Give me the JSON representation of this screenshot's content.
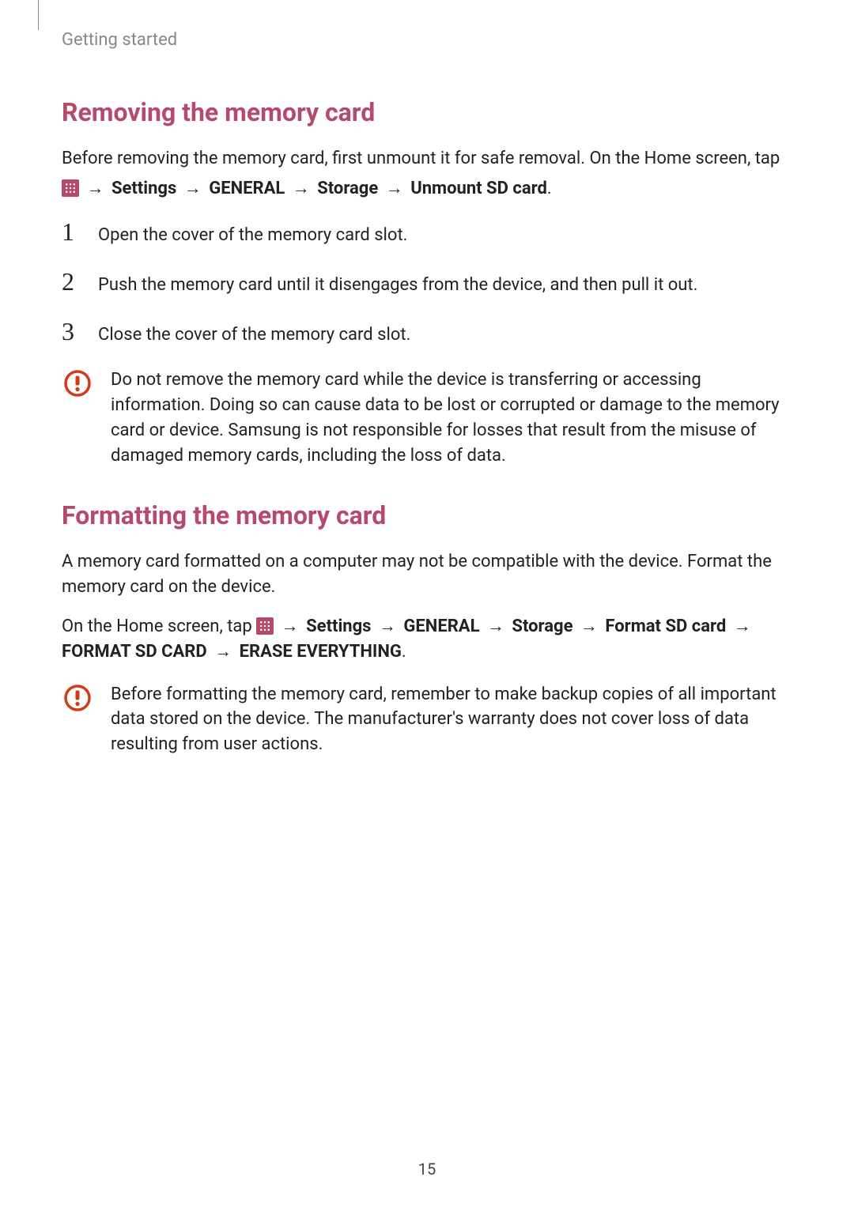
{
  "header": {
    "section_label": "Getting started"
  },
  "section1": {
    "title": "Removing the memory card",
    "intro": "Before removing the memory card, first unmount it for safe removal. On the Home screen, tap ",
    "nav": {
      "settings": "Settings",
      "general": "GENERAL",
      "storage": "Storage",
      "unmount": "Unmount SD card"
    },
    "steps": [
      "Open the cover of the memory card slot.",
      "Push the memory card until it disengages from the device, and then pull it out.",
      "Close the cover of the memory card slot."
    ],
    "caution": "Do not remove the memory card while the device is transferring or accessing information. Doing so can cause data to be lost or corrupted or damage to the memory card or device. Samsung is not responsible for losses that result from the misuse of damaged memory cards, including the loss of data."
  },
  "section2": {
    "title": "Formatting the memory card",
    "intro": "A memory card formatted on a computer may not be compatible with the device. Format the memory card on the device.",
    "nav_lead": "On the Home screen, tap ",
    "nav": {
      "settings": "Settings",
      "general": "GENERAL",
      "storage": "Storage",
      "format": "Format SD card",
      "format_caps": "FORMAT SD CARD",
      "erase": "ERASE EVERYTHING"
    },
    "caution": "Before formatting the memory card, remember to make backup copies of all important data stored on the device. The manufacturer's warranty does not cover loss of data resulting from user actions."
  },
  "page_number": "15",
  "glyphs": {
    "arrow": "→"
  }
}
